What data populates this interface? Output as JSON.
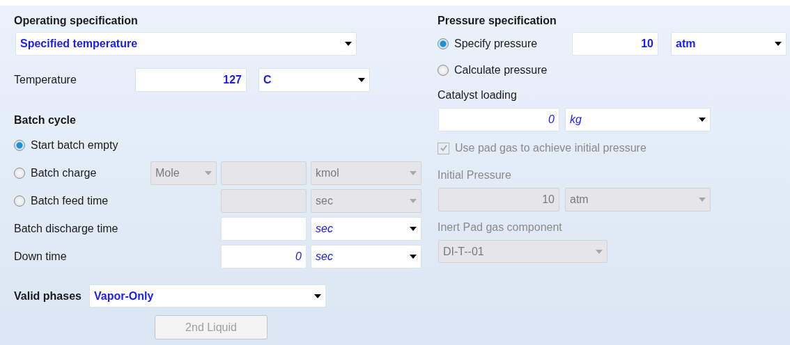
{
  "operating_specification": {
    "heading": "Operating specification",
    "select": {
      "value": "Specified temperature",
      "kind": "entered"
    }
  },
  "temperature": {
    "label": "Temperature",
    "amount": {
      "value": "127",
      "kind": "entered"
    },
    "unit": {
      "value": "C",
      "kind": "entered"
    }
  },
  "batch_cycle": {
    "heading": "Batch cycle",
    "options": [
      {
        "label": "Start batch empty",
        "selected": true
      },
      {
        "label": "Batch charge",
        "selected": false,
        "basis": {
          "value": "Mole",
          "kind": "disabled"
        },
        "amount": {
          "kind": "disabled"
        },
        "unit": {
          "value": "kmol",
          "kind": "disabled"
        }
      },
      {
        "label": "Batch feed time",
        "selected": false,
        "amount": {
          "kind": "disabled"
        },
        "unit": {
          "value": "sec",
          "kind": "disabled"
        }
      }
    ],
    "rows": [
      {
        "label": "Batch discharge time",
        "amount": {
          "kind": "entered"
        },
        "unit": {
          "value": "sec",
          "kind": "default"
        }
      },
      {
        "label": "Down time",
        "amount": {
          "value": "0",
          "kind": "default"
        },
        "unit": {
          "value": "sec",
          "kind": "default"
        }
      }
    ]
  },
  "valid_phases": {
    "label": "Valid phases",
    "select": {
      "value": "Vapor-Only",
      "kind": "entered"
    }
  },
  "second_liquid_button": {
    "label": "2nd Liquid",
    "disabled": true
  },
  "pressure_specification": {
    "heading": "Pressure specification",
    "options": [
      {
        "label": "Specify pressure",
        "selected": true,
        "amount": {
          "value": "10",
          "kind": "entered"
        },
        "unit": {
          "value": "atm",
          "kind": "entered"
        }
      },
      {
        "label": "Calculate pressure",
        "selected": false
      }
    ]
  },
  "catalyst_loading": {
    "label": "Catalyst loading",
    "amount": {
      "value": "0",
      "kind": "default"
    },
    "unit": {
      "value": "kg",
      "kind": "default"
    }
  },
  "pad_gas": {
    "label": "Use pad gas to achieve initial pressure",
    "checked": true,
    "disabled": true
  },
  "initial_pressure": {
    "label": "Initial Pressure",
    "disabled": true,
    "amount": {
      "value": "10",
      "kind": "disabled"
    },
    "unit": {
      "value": "atm",
      "kind": "disabled"
    }
  },
  "inert_pad_gas": {
    "label": "Inert Pad gas component",
    "disabled": true,
    "select": {
      "value": "DI-T--01",
      "kind": "disabled"
    }
  }
}
